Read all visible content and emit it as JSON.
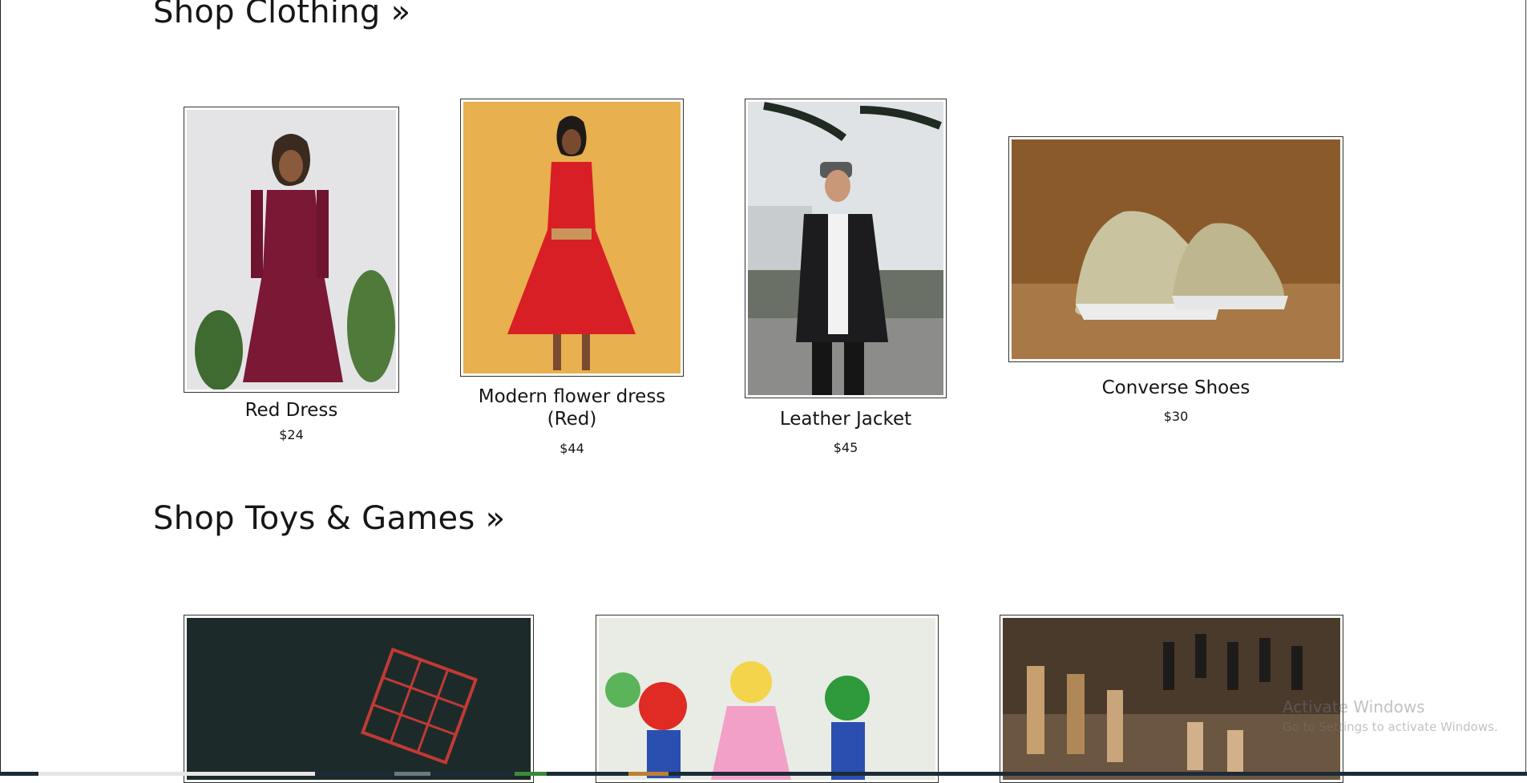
{
  "sections": [
    {
      "title": "Shop Clothing »",
      "products": [
        {
          "name": "Red Dress",
          "price": "$24",
          "image": "woman-in-burgundy-dress-photo"
        },
        {
          "name": "Modern flower dress (Red)",
          "price": "$44",
          "image": "woman-in-red-floral-dress-photo"
        },
        {
          "name": "Leather Jacket",
          "price": "$45",
          "image": "man-in-leather-jacket-photo"
        },
        {
          "name": "Converse Shoes",
          "price": "$30",
          "image": "converse-sneakers-photo"
        }
      ]
    },
    {
      "title": "Shop Toys & Games »",
      "products": [
        {
          "name": "",
          "price": "",
          "image": "rubiks-cube-photo"
        },
        {
          "name": "",
          "price": "",
          "image": "mario-figures-photo"
        },
        {
          "name": "",
          "price": "",
          "image": "chess-pieces-photo"
        }
      ]
    }
  ],
  "windows_watermark": {
    "title": "Activate Windows",
    "subtitle": "Go to Settings to activate Windows."
  }
}
